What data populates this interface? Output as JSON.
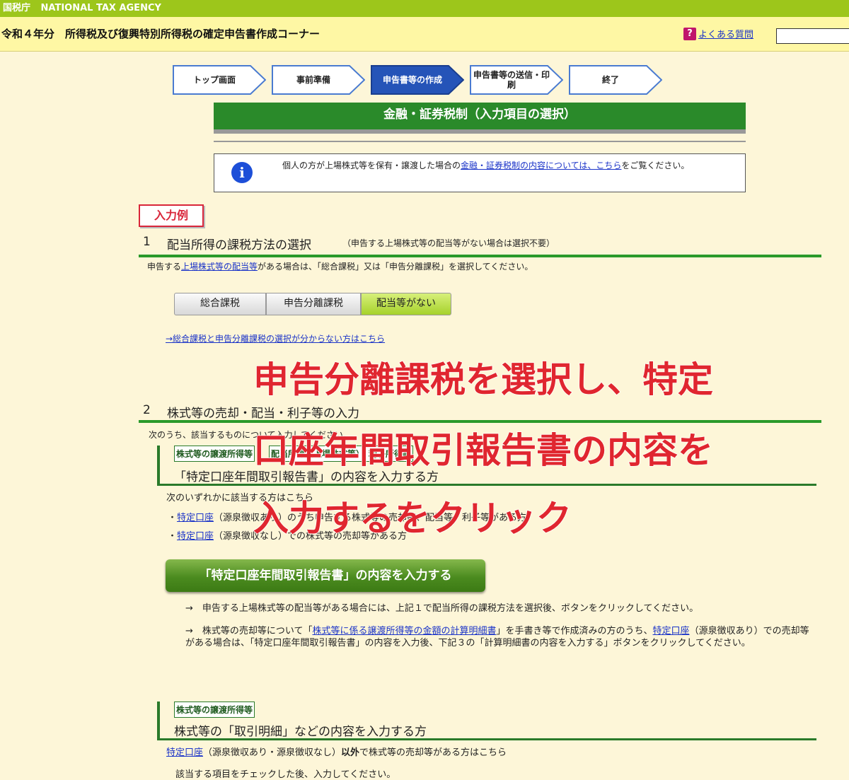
{
  "header": {
    "agency_jp": "国税庁",
    "agency_en": "NATIONAL TAX AGENCY",
    "page_title": "令和４年分　所得税及び復興特別所得税の確定申告書作成コーナー",
    "faq_label": "よくある質問",
    "faq_icon": "question-icon"
  },
  "steps": [
    {
      "label": "トップ画面"
    },
    {
      "label": "事前準備"
    },
    {
      "label": "申告書等の作成"
    },
    {
      "label": "申告書等の送信・印刷"
    },
    {
      "label": "終了"
    }
  ],
  "banner_title": "金融・証券税制（入力項目の選択）",
  "info": {
    "icon": "info-icon",
    "text_before": "個人の方が上場株式等を保有・譲渡した場合の",
    "link": "金融・証券税制の内容については、こちら",
    "text_after": "をご覧ください。"
  },
  "example_label": "入力例",
  "section1": {
    "number": "1",
    "title": "配当所得の課税方法の選択",
    "subtitle": "（申告する上場株式等の配当等がない場合は選択不要）",
    "desc_before": "申告する",
    "desc_link": "上場株式等の配当等",
    "desc_after": "がある場合は、「総合課税」又は「申告分離課税」を選択してください。",
    "options": [
      "総合課税",
      "申告分離課税",
      "配当等がない"
    ],
    "help_link": "→総合課税と申告分離課税の選択が分からない方はこちら"
  },
  "section2": {
    "number": "2",
    "title": "株式等の売却・配当・利子等の入力",
    "desc": "次のうち、該当するものについて入力してください。",
    "block1": {
      "tag1": "株式等の譲渡所得等",
      "tag2": "配当所得（上場株式等）・利子所得等",
      "title": "「特定口座年間取引報告書」の内容を入力する方",
      "sub": "次のいずれかに該当する方はこちら",
      "item1_link": "特定口座",
      "item1_text": "（源泉徴収あり）のうち申告する株式等の売却等、配当等、利子等がある方",
      "item2_link": "特定口座",
      "item2_text": "（源泉徴収なし）での株式等の売却等がある方",
      "button": "「特定口座年間取引報告書」の内容を入力する",
      "note1": "→　申告する上場株式等の配当等がある場合には、上記１で配当所得の課税方法を選択後、ボタンをクリックしてください。",
      "note2_a": "→　株式等の売却等について「",
      "note2_link1": "株式等に係る譲渡所得等の金額の計算明細書",
      "note2_b": "」を手書き等で作成済みの方のうち、",
      "note2_link2": "特定口座",
      "note2_c": "（源泉徴収あり）での売却等がある場合は、「特定口座年間取引報告書」の内容を入力後、下記３の「計算明細書の内容を入力する」ボタンをクリックしてください。"
    },
    "block2": {
      "tag1": "株式等の譲渡所得等",
      "title": "株式等の「取引明細」などの内容を入力する方",
      "desc_link": "特定口座",
      "desc_a": "（源泉徴収あり・源泉徴収なし）",
      "desc_bold": "以外",
      "desc_b": "で株式等の売却等がある方はこちら",
      "check_text": "該当する項目をチェックした後、入力してください。"
    }
  },
  "overlay": {
    "line1": "申告分離課税を選択し、特定",
    "line2": "口座年間取引報告書の内容を",
    "line3": "入力するをクリック"
  }
}
